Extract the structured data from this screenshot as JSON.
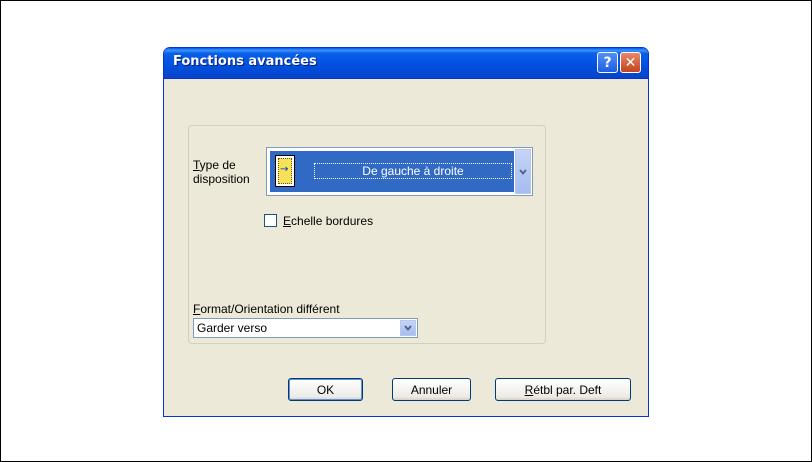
{
  "dialog": {
    "title": "Fonctions avancées",
    "help_glyph": "?",
    "close_glyph": "✕"
  },
  "layout": {
    "label_line1": "Type de",
    "label_line2": "disposition",
    "selected_value": "De gauche à droite",
    "icon_arrow": "→"
  },
  "scale_borders": {
    "label": "Echelle bordures",
    "checked": false
  },
  "format": {
    "label": "Format/Orientation différent",
    "selected_value": "Garder verso"
  },
  "buttons": {
    "ok": "OK",
    "cancel": "Annuler",
    "reset": "Rétbl par. Deft"
  },
  "colors": {
    "titlebar": "#0a5fe8",
    "dialog_bg": "#ece9d8",
    "selection": "#316ac5"
  }
}
